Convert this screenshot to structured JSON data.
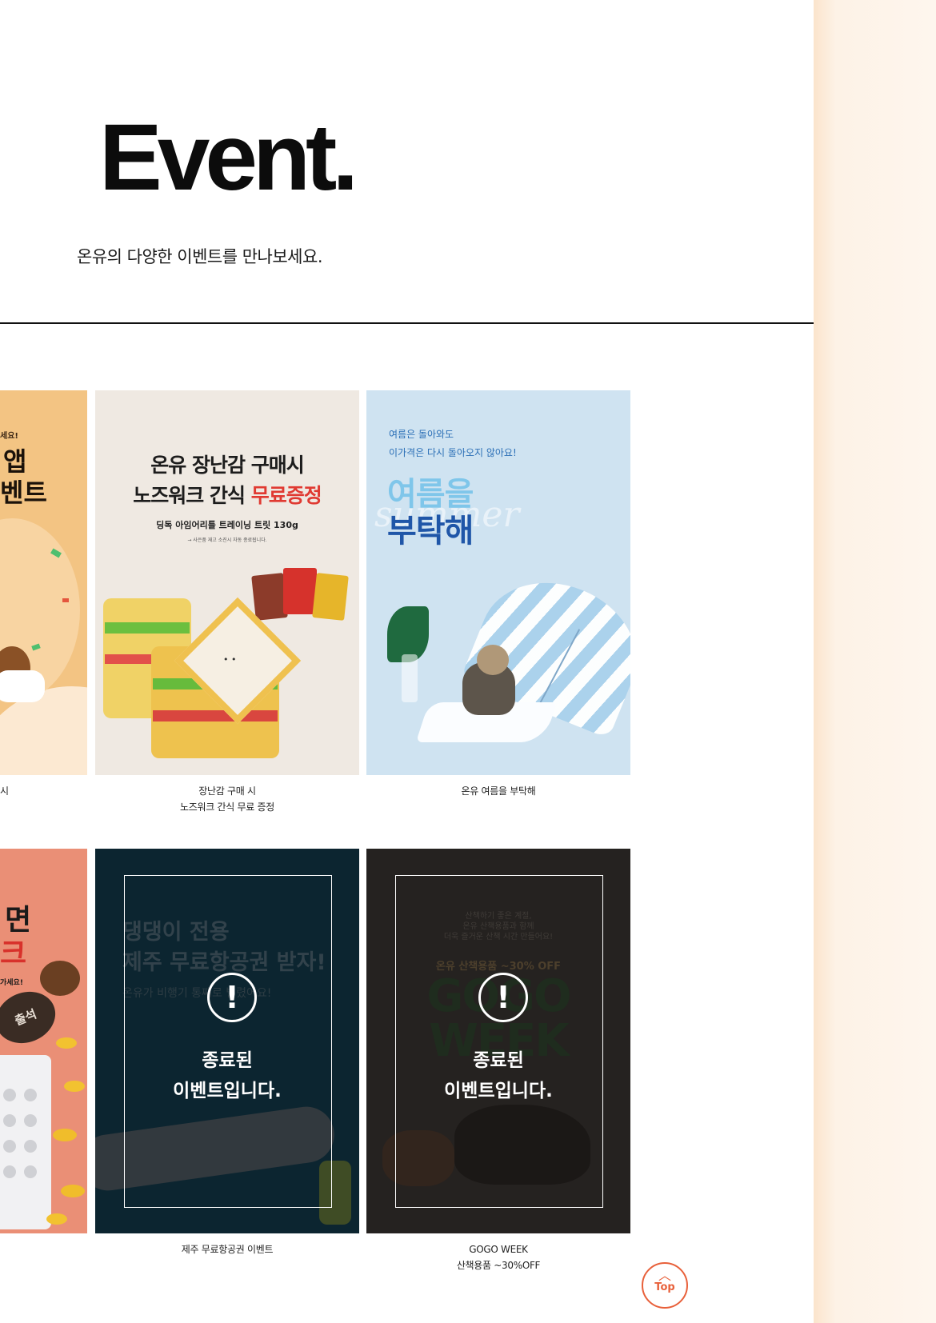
{
  "header": {
    "title": "Event.",
    "subtitle": "온유의 다양한 이벤트를 만나보세요."
  },
  "events": {
    "row1": {
      "partial": {
        "line1": "세요!",
        "line2": "앱",
        "line3": "벤트",
        "caption": "시"
      },
      "toy": {
        "headline1": "온유 장난감 구매시",
        "headline2a": "노즈워크 간식 ",
        "headline2b": "무료증정",
        "product": "딩독 아임어리틀 트레이닝 트릿 130g",
        "fineprint": "→ 사은품 재고 소진시 자동 종료됩니다.",
        "caption_line1": "장난감 구매 시",
        "caption_line2": "노즈워크 간식 무료 증정"
      },
      "summer": {
        "tagline1": "여름은 돌아와도",
        "tagline2": "이가격은 다시 돌아오지 않아요!",
        "title1": "여름을",
        "title2": "부탁해",
        "watermark": "summer",
        "caption": "온유 여름을 부탁해"
      }
    },
    "row2": {
      "partial": {
        "big1": "면",
        "big2": "크",
        "small": "가세요!",
        "stamp": "출석"
      },
      "jeju": {
        "line1": "댕댕이 전용",
        "line2": "제주 무료항공권 받자!",
        "line3": "온유가 비행기 통째로 빌렸어요!",
        "ended_line1": "종료된",
        "ended_line2": "이벤트입니다.",
        "caption": "제주 무료항공권 이벤트"
      },
      "gogo": {
        "text1": "산책하기 좋은 계절,",
        "text2": "온유 산책용품과 함께",
        "text3": "더욱 즐거운 산책 시간 만들어요!",
        "sale": "온유 산책용품 ~30% OFF",
        "big1": "GOGO",
        "big2": "WEEK",
        "ended_line1": "종료된",
        "ended_line2": "이벤트입니다.",
        "caption_line1": "GOGO WEEK",
        "caption_line2": "산책용품 ~30%OFF"
      }
    }
  },
  "ended_icon": "!",
  "top_button": {
    "chevron": "︿",
    "label": "Top"
  },
  "colors": {
    "accent": "#e8603a",
    "summer_bg": "#cfe3f1",
    "jeju_bg": "#0b2a38",
    "gogo_bg": "#2a2624",
    "toy_bg": "#efe9e2",
    "partial1_bg": "#f3c483",
    "partial2_bg": "#ea8f76"
  }
}
